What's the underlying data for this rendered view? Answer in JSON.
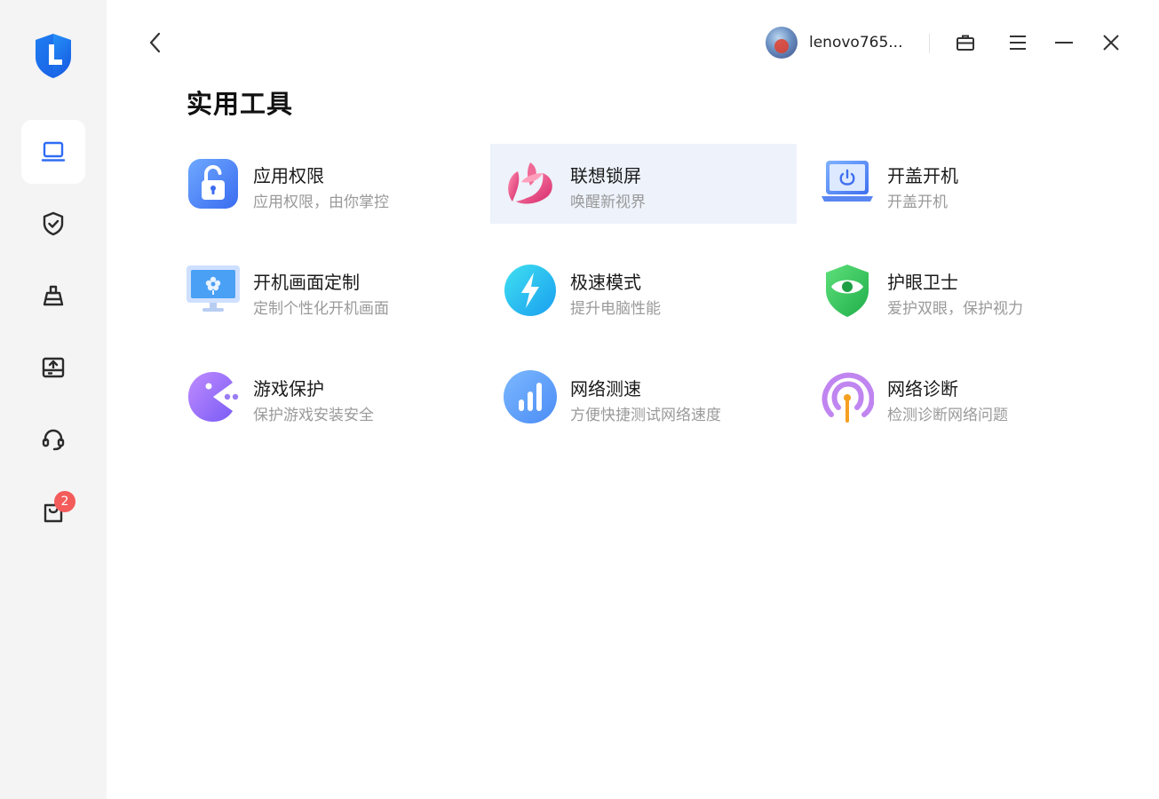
{
  "user": {
    "name": "lenovo765..."
  },
  "sidebar": {
    "cart_badge": "2"
  },
  "page": {
    "title": "实用工具"
  },
  "tools": [
    {
      "name": "应用权限",
      "desc": "应用权限，由你掌控",
      "icon": "unlock-icon"
    },
    {
      "name": "联想锁屏",
      "desc": "唤醒新视界",
      "icon": "lockscreen-logo-icon"
    },
    {
      "name": "开盖开机",
      "desc": "开盖开机",
      "icon": "laptop-power-icon"
    },
    {
      "name": "开机画面定制",
      "desc": "定制个性化开机画面",
      "icon": "monitor-flower-icon"
    },
    {
      "name": "极速模式",
      "desc": "提升电脑性能",
      "icon": "lightning-icon"
    },
    {
      "name": "护眼卫士",
      "desc": "爱护双眼，保护视力",
      "icon": "eye-shield-icon"
    },
    {
      "name": "游戏保护",
      "desc": "保护游戏安装安全",
      "icon": "pacman-icon"
    },
    {
      "name": "网络测速",
      "desc": "方便快捷测试网络速度",
      "icon": "signal-bars-icon"
    },
    {
      "name": "网络诊断",
      "desc": "检测诊断网络问题",
      "icon": "antenna-icon"
    }
  ],
  "colors": {
    "accent": "#2f6cf5",
    "sidebar_bg": "#f4f4f5",
    "highlight_bg": "#edf2fb",
    "badge": "#f45b5b"
  }
}
